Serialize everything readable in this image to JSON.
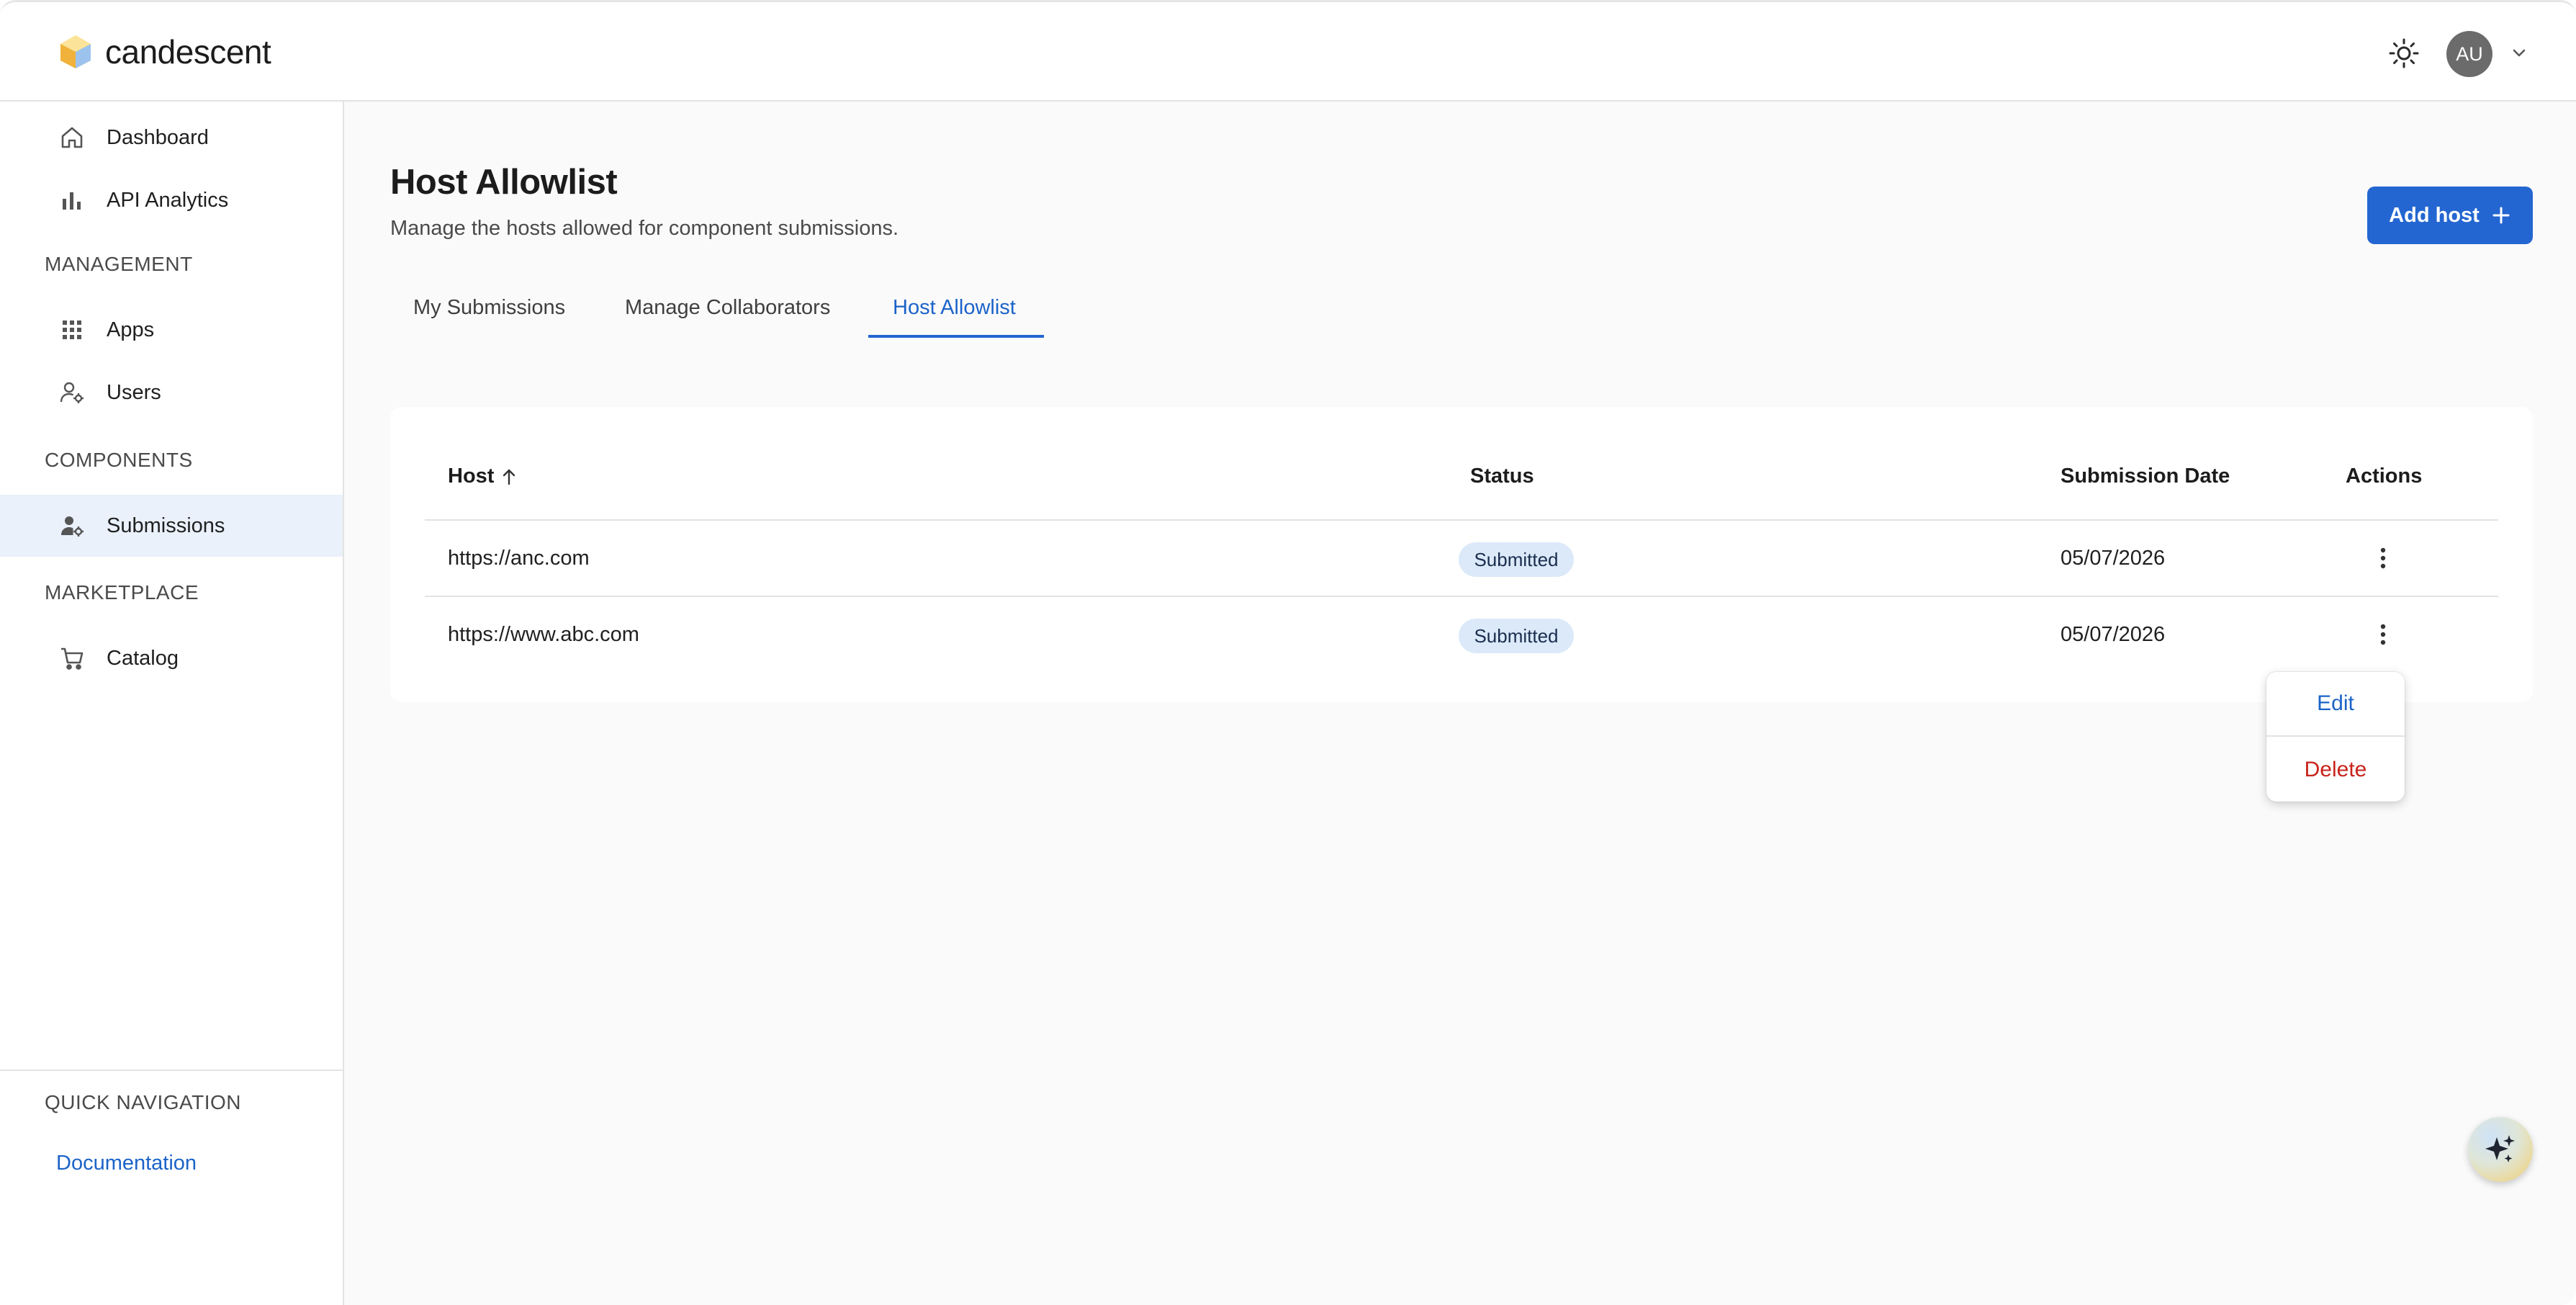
{
  "brand": {
    "name": "candescent"
  },
  "header": {
    "avatar_initials": "AU"
  },
  "sidebar": {
    "top_items": [
      {
        "label": "Dashboard",
        "icon": "home-icon"
      },
      {
        "label": "API Analytics",
        "icon": "bar-chart-icon"
      }
    ],
    "sections": [
      {
        "label": "MANAGEMENT",
        "items": [
          {
            "label": "Apps",
            "icon": "grid-icon"
          },
          {
            "label": "Users",
            "icon": "user-gear-icon"
          }
        ]
      },
      {
        "label": "COMPONENTS",
        "items": [
          {
            "label": "Submissions",
            "icon": "user-gear-filled-icon",
            "active": true
          }
        ]
      },
      {
        "label": "MARKETPLACE",
        "items": [
          {
            "label": "Catalog",
            "icon": "cart-icon"
          }
        ]
      }
    ],
    "quick_nav": {
      "label": "QUICK NAVIGATION",
      "link": "Documentation"
    }
  },
  "page": {
    "title": "Host Allowlist",
    "subtitle": "Manage the hosts allowed for component submissions.",
    "add_button": "Add host"
  },
  "tabs": [
    {
      "label": "My Submissions"
    },
    {
      "label": "Manage Collaborators"
    },
    {
      "label": "Host Allowlist",
      "active": true
    }
  ],
  "table": {
    "columns": {
      "host": "Host",
      "status": "Status",
      "date": "Submission Date",
      "actions": "Actions"
    },
    "rows": [
      {
        "host": "https://anc.com",
        "status": "Submitted",
        "date": "05/07/2026"
      },
      {
        "host": "https://www.abc.com",
        "status": "Submitted",
        "date": "05/07/2026"
      }
    ]
  },
  "row_menu": {
    "edit": "Edit",
    "delete": "Delete"
  },
  "colors": {
    "accent": "#2466d1",
    "danger": "#c8231b",
    "badge_bg": "#dbe9f9"
  }
}
